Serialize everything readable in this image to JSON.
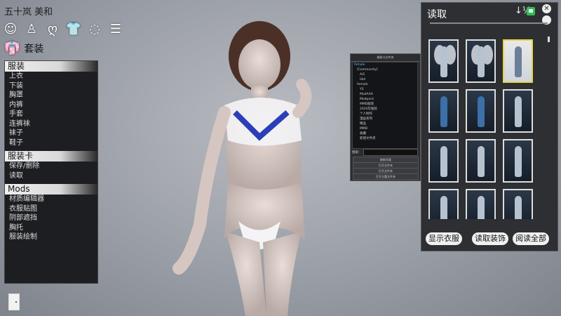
{
  "header": {
    "character_name": "五十岚 美和",
    "categories": [
      {
        "icon": "face-icon"
      },
      {
        "icon": "body-icon"
      },
      {
        "icon": "hair-icon"
      },
      {
        "icon": "clothes-icon",
        "active": true
      },
      {
        "icon": "accessory-icon"
      },
      {
        "icon": "list-icon"
      }
    ],
    "section_title": "套装"
  },
  "sidebar": {
    "groups": [
      {
        "title": "服装",
        "items": [
          "上衣",
          "下装",
          "胸罩",
          "内裤",
          "手套",
          "连裤袜",
          "袜子",
          "鞋子"
        ]
      },
      {
        "title": "服装卡",
        "items": [
          "保存/删除",
          "读取"
        ]
      },
      {
        "title": "Mods",
        "items": [
          "材质编辑器",
          "衣服贴图",
          "阴部遮挡",
          "胸托",
          "服装绘制"
        ]
      }
    ]
  },
  "folder_dialog": {
    "title": "服装卡文件夹",
    "tree": [
      "female",
      "[Community]",
      "AiS",
      "Idol",
      "female",
      "YS",
      "ModAAA",
      "Modpack",
      "MMD服装",
      "2020年服装",
      "个人制作",
      "漫画系列",
      "精品",
      "MMD",
      "收藏",
      "新建文件夹"
    ],
    "search_label": "搜索:",
    "buttons": [
      "刷新列表",
      "打开文件夹",
      "打开文件夹",
      "打开主题文件夹"
    ]
  },
  "right_panel": {
    "title": "读取",
    "sort_glyph": "↓½",
    "thumbnails": [
      {
        "style": "angel"
      },
      {
        "style": "angel"
      },
      {
        "style": "plain",
        "selected": true
      },
      {
        "style": "armor"
      },
      {
        "style": "armor"
      },
      {
        "style": "plain"
      },
      {
        "style": "plain"
      },
      {
        "style": "plain"
      },
      {
        "style": "plain"
      },
      {
        "style": "plain"
      },
      {
        "style": "plain"
      },
      {
        "style": "plain"
      }
    ],
    "buttons": {
      "show_clothes": "显示衣服",
      "load_accessories": "读取装饰",
      "read_all": "阅读全部"
    }
  },
  "colors": {
    "accent": "#e5d44a",
    "panel": "#2e2f33",
    "save": "#2fbf4b"
  }
}
